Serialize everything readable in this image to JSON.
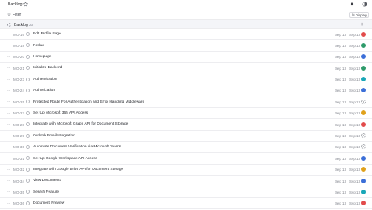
{
  "header": {
    "title": "Backlog"
  },
  "toolbar": {
    "filter_label": "Filter",
    "display_label": "Display"
  },
  "group": {
    "name": "Backlog",
    "count": "23"
  },
  "issues": [
    {
      "id": "MO-16",
      "title": "Edit Profile Page",
      "date": "Sep 13",
      "date2": "Sep 13",
      "avatar_color": "#e24b4b"
    },
    {
      "id": "MO-18",
      "title": "Redux",
      "date": "Sep 13",
      "date2": "Sep 13",
      "avatar_color": "#2e9b6b"
    },
    {
      "id": "MO-20",
      "title": "Homepage",
      "date": "Sep 13",
      "date2": "Sep 13",
      "avatar_color": "#3c6fd8"
    },
    {
      "id": "MO-21",
      "title": "Initialize Backend",
      "date": "Sep 13",
      "date2": "Sep 13",
      "avatar_color": "#2e9b6b"
    },
    {
      "id": "MO-23",
      "title": "Authentication",
      "date": "Sep 13",
      "date2": "Sep 13",
      "avatar_color": "#19a7b8"
    },
    {
      "id": "MO-24",
      "title": "Authorization",
      "date": "Sep 13",
      "date2": "Sep 13",
      "avatar_color": "#3c6fd8"
    },
    {
      "id": "MO-25",
      "title": "Protected Route For Authentication and Error Handling Middleware",
      "date": "Sep 13",
      "date2": "Sep 13",
      "avatar_color": ""
    },
    {
      "id": "MO-27",
      "title": "Set Up Microsoft 365 API Access",
      "date": "Sep 13",
      "date2": "Sep 13",
      "avatar_color": "#e0a11b"
    },
    {
      "id": "MO-28",
      "title": "Integrate with Microsoft Graph API for Document Storage",
      "date": "Sep 13",
      "date2": "Sep 13",
      "avatar_color": "#e24b4b"
    },
    {
      "id": "MO-29",
      "title": "Outlook Email Integration",
      "date": "Sep 13",
      "date2": "Sep 13",
      "avatar_color": ""
    },
    {
      "id": "MO-30",
      "title": "Automate Document Verification via Microsoft Teams",
      "date": "Sep 13",
      "date2": "Sep 13",
      "avatar_color": ""
    },
    {
      "id": "MO-31",
      "title": "Set Up Google Workspace API Access",
      "date": "Sep 13",
      "date2": "Sep 13",
      "avatar_color": "#3c6fd8"
    },
    {
      "id": "MO-32",
      "title": "Integrate with Google Drive API for Document Storage",
      "date": "Sep 13",
      "date2": "Sep 13",
      "avatar_color": "#e0a11b"
    },
    {
      "id": "MO-34",
      "title": "View Documents",
      "date": "Sep 13",
      "date2": "Sep 13",
      "avatar_color": "#3c6fd8"
    },
    {
      "id": "MO-35",
      "title": "Search Feature",
      "date": "Sep 13",
      "date2": "Sep 13",
      "avatar_color": "#19a7b8"
    },
    {
      "id": "MO-36",
      "title": "Document Preview",
      "date": "Sep 13",
      "date2": "Sep 13",
      "avatar_color": "#e24b4b"
    }
  ]
}
